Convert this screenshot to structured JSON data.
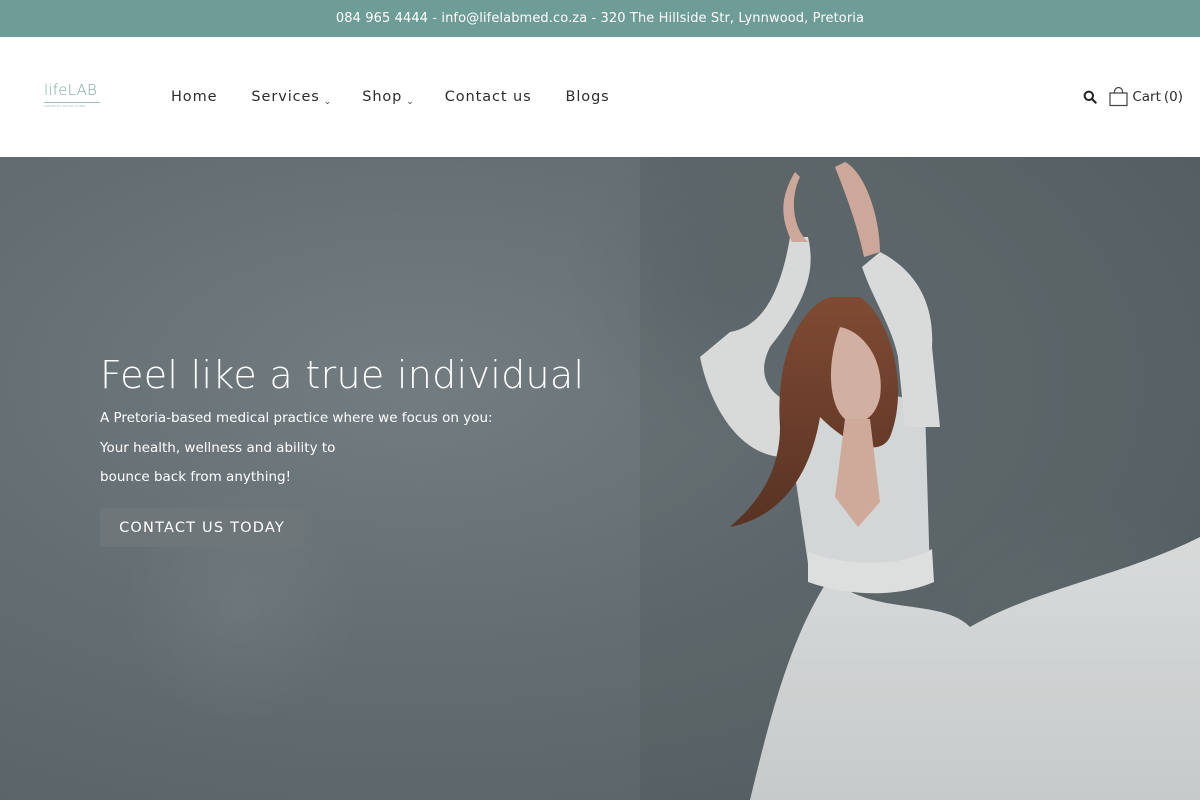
{
  "topbar": {
    "contact_line": "084 965 4444 - info@lifelabmed.co.za - 320 The Hillside Str, Lynnwood, Pretoria"
  },
  "header": {
    "logo_text": "lifeLAB",
    "logo_tagline": "LONGEVITY DETOX LIVING",
    "nav": [
      {
        "label": "Home",
        "has_submenu": false
      },
      {
        "label": "Services",
        "has_submenu": true
      },
      {
        "label": "Shop",
        "has_submenu": true
      },
      {
        "label": "Contact us",
        "has_submenu": false
      },
      {
        "label": "Blogs",
        "has_submenu": false
      }
    ],
    "search_icon": "search-icon",
    "cart_label": "Cart",
    "cart_count": "(0)"
  },
  "hero": {
    "title": "Feel like a true individual",
    "lines": [
      "A Pretoria-based medical practice where we focus on you:",
      "Your health, wellness and ability to",
      "bounce back from anything!"
    ],
    "cta_label": "CONTACT US TODAY"
  },
  "colors": {
    "topbar_bg": "#6e9c97",
    "hero_bg": "#646e72",
    "cta_bg": "#6f7679"
  }
}
